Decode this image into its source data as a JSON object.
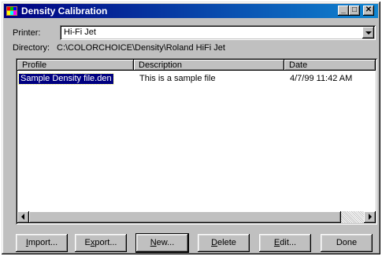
{
  "window": {
    "title": "Density Calibration",
    "controls": {
      "minimize": "_",
      "maximize": "□",
      "close": "✕"
    }
  },
  "printer": {
    "label": "Printer:",
    "value": "Hi-Fi Jet"
  },
  "directory": {
    "label": "Directory:",
    "value": "C:\\COLORCHOICE\\Density\\Roland HiFi Jet"
  },
  "list": {
    "columns": [
      "Profile",
      "Description",
      "Date"
    ],
    "rows": [
      {
        "profile": "Sample Density file.den",
        "description": "This is a sample file",
        "date": "4/7/99 11:42 AM",
        "selected": true
      }
    ]
  },
  "buttons": [
    {
      "pre": "",
      "key": "I",
      "post": "mport..."
    },
    {
      "pre": "E",
      "key": "x",
      "post": "port..."
    },
    {
      "pre": "",
      "key": "N",
      "post": "ew..."
    },
    {
      "pre": "",
      "key": "D",
      "post": "elete"
    },
    {
      "pre": "",
      "key": "E",
      "post": "dit..."
    },
    {
      "pre": "Done",
      "key": "",
      "post": ""
    }
  ],
  "icons": {
    "app": "color-palette-icon",
    "dropdown": "chevron-down-icon",
    "scroll_left": "arrow-left-icon",
    "scroll_right": "arrow-right-icon"
  },
  "colors": {
    "titlebar": "#000080",
    "selection": "#000080",
    "face": "#c0c0c0"
  }
}
